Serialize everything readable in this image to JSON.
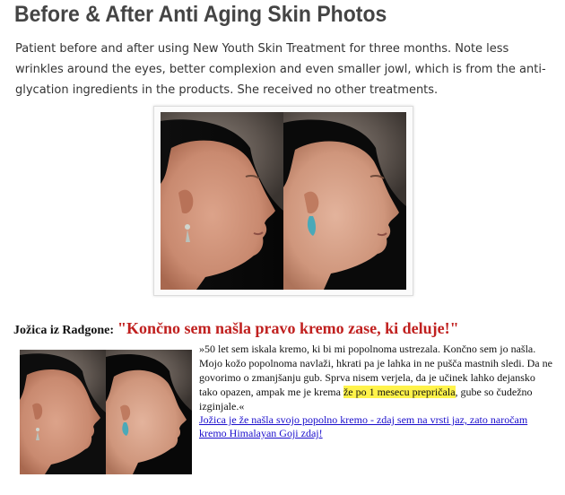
{
  "article": {
    "title": "Before & After Anti Aging Skin Photos",
    "description": "Patient before and after using New Youth Skin Treatment for three months. Note less wrinkles around the eyes, better complexion and even smaller jowl, which is from the anti-glycation ingredients in the products. She received no other treatments."
  },
  "testimonial": {
    "author": "Jožica iz Radgone:",
    "headline": "\"Končno sem našla pravo kremo zase, ki deluje!\"",
    "body_before": "»50 let sem iskala kremo, ki bi mi popolnoma ustrezala. Končno sem jo našla. Mojo kožo popolnoma navlaži, hkrati pa je lahka in ne pušča mastnih sledi. Da ne govorimo o zmanjšanju gub. Sprva nisem verjela, da je učinek lahko dejansko tako opazen, ampak me je krema ",
    "body_highlight": "že po 1 mesecu prepričala",
    "body_after": ", gube so čudežno izginjale.«",
    "link_text": "Jožica je že našla svojo popolno kremo - zdaj sem na vrsti jaz, zato naročam kremo Himalayan Goji zdaj!"
  },
  "colors": {
    "headline_red": "#c0201f",
    "highlight_yellow": "#fff34a",
    "link_blue": "#1a0dcc"
  }
}
